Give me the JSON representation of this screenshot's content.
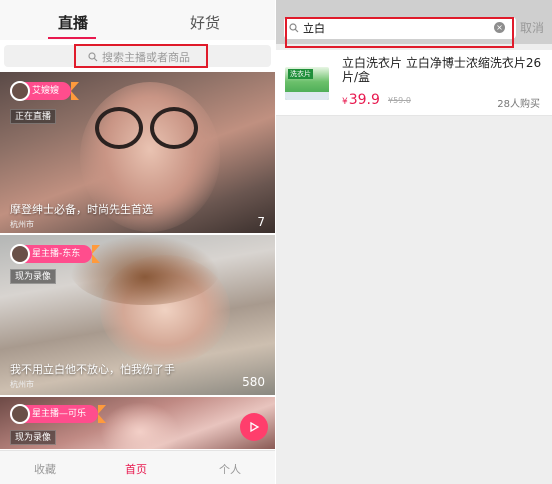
{
  "left": {
    "tabs": [
      {
        "label": "直播"
      },
      {
        "label": "好货"
      }
    ],
    "search_placeholder": "搜索主播或者商品",
    "cards": [
      {
        "host": "艾嫂嫂",
        "badge": "正在直播",
        "title": "摩登绅士必备，时尚先生首选",
        "city": "杭州市",
        "count": "7"
      },
      {
        "host": "星主播-东东",
        "badge": "现为录像",
        "title": "我不用立白他不放心，怕我伤了手",
        "city": "杭州市",
        "count": "580"
      },
      {
        "host": "星主播—可乐",
        "badge": "现为录像"
      }
    ],
    "bottom_nav": [
      {
        "label": "收藏"
      },
      {
        "label": "首页"
      },
      {
        "label": "个人"
      }
    ]
  },
  "right": {
    "search_query": "立白",
    "cancel_label": "取消",
    "result": {
      "title": "立白洗衣片 立白净博士浓缩洗衣片26片/盒",
      "currency": "¥",
      "price": "39.9",
      "old_price": "¥59.0",
      "sold": "28人购买",
      "image_label": "洗衣片"
    }
  },
  "colors": {
    "accent": "#e8194f",
    "tag_pink": "#ff4d8d",
    "tag_orange": "#ff9a3c",
    "highlight_box": "#e01b2b"
  }
}
